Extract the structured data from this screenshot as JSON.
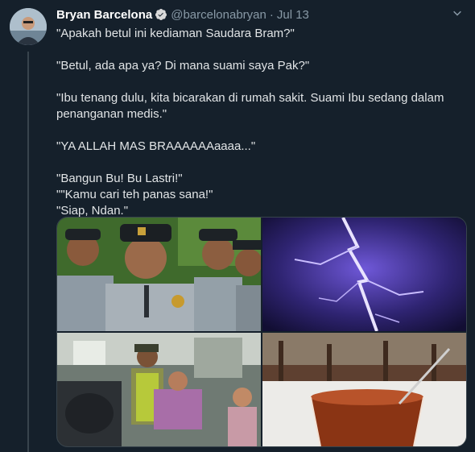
{
  "tweet": {
    "display_name": "Bryan Barcelona",
    "verified_icon": "verified-badge-icon",
    "handle": "@barcelonabryan",
    "separator": "·",
    "date": "Jul 13",
    "more_icon": "chevron-down-icon",
    "lines": [
      "\"Apakah betul ini kediaman Saudara Bram?\"",
      "\"Betul, ada apa ya? Di mana suami saya Pak?\"",
      "\"Ibu tenang dulu, kita bicarakan di rumah sakit. Suami Ibu sedang dalam penanganan medis.\"",
      "\"YA ALLAH MAS BRAAAAAAaaaa...\"",
      "\"Bangun Bu! Bu Lastri!\"",
      "\"\"Kamu cari teh panas sana!\"",
      "\"Siap, Ndan.\""
    ]
  },
  "media": {
    "photos": [
      "police-officers-photo",
      "lightning-photo",
      "fainted-woman-photo",
      "hot-tea-photo"
    ]
  },
  "colors": {
    "background": "#15202b",
    "text": "#e1e4e6",
    "muted": "#8899a6",
    "verified": "#1da1f2",
    "border": "#38444d"
  }
}
